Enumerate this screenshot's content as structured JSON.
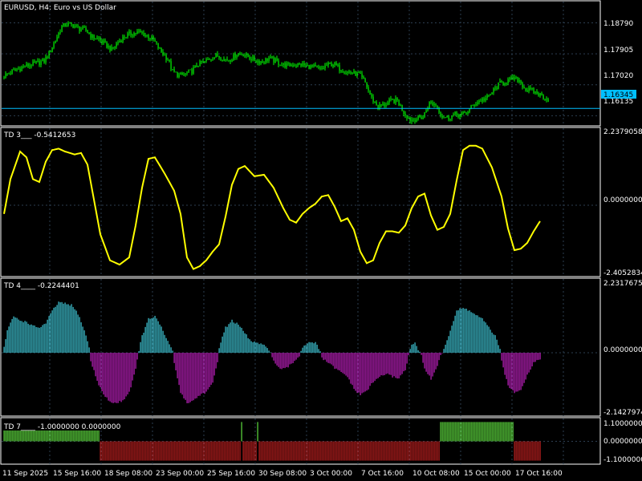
{
  "window": {
    "title": "EURUSD, H4:  Euro vs US Dollar"
  },
  "colors": {
    "background": "#000000",
    "grid": "#2c3e50",
    "border": "#ffffff",
    "candle": "#00ff00",
    "bid_line": "#00bfff",
    "td3_line": "#ffff00",
    "td4_pos": "#40c8d8",
    "td4_neg": "#c020c0",
    "td7_pos": "#60e040",
    "td7_neg": "#c02020",
    "text": "#ffffff"
  },
  "price_panel": {
    "price_labels": [
      "1.18790",
      "1.17905",
      "1.17020",
      "1.16135"
    ],
    "current_price": "1.16345"
  },
  "td3_panel": {
    "label": "TD 3___ -0.5412653",
    "scale_labels": [
      "2.2379058",
      "0.0000000",
      "-2.4052834"
    ]
  },
  "td4_panel": {
    "label": "TD 4____ -0.2244401",
    "scale_labels": [
      "2.2317675",
      "0.0000000",
      "-2.1427974"
    ]
  },
  "td7_panel": {
    "label": "TD 7____ -1.0000000 0.0000000",
    "scale_labels": [
      "1.1000000",
      "0.0000000",
      "-1.1000000"
    ]
  },
  "time_axis": {
    "labels": [
      "11 Sep 2025",
      "15 Sep 16:00",
      "18 Sep 08:00",
      "23 Sep 00:00",
      "25 Sep 16:00",
      "30 Sep 08:00",
      "3 Oct 00:00",
      "7 Oct 16:00",
      "10 Oct 08:00",
      "15 Oct 00:00",
      "17 Oct 16:00"
    ]
  },
  "chart_data": [
    {
      "type": "candlestick",
      "title": "EURUSD, H4:  Euro vs US Dollar",
      "price_anchors": [
        [
          0,
          1.1725
        ],
        [
          6,
          1.174
        ],
        [
          14,
          1.1755
        ],
        [
          20,
          1.1762
        ],
        [
          26,
          1.177
        ],
        [
          30,
          1.18
        ],
        [
          33,
          1.183
        ],
        [
          37,
          1.1868
        ],
        [
          40,
          1.1875
        ],
        [
          44,
          1.1872
        ],
        [
          48,
          1.1862
        ],
        [
          52,
          1.1858
        ],
        [
          56,
          1.1838
        ],
        [
          60,
          1.1832
        ],
        [
          64,
          1.1818
        ],
        [
          68,
          1.1802
        ],
        [
          72,
          1.1824
        ],
        [
          76,
          1.184
        ],
        [
          80,
          1.1848
        ],
        [
          85,
          1.1852
        ],
        [
          90,
          1.1843
        ],
        [
          94,
          1.183
        ],
        [
          98,
          1.1802
        ],
        [
          103,
          1.1775
        ],
        [
          106,
          1.174
        ],
        [
          110,
          1.1728
        ],
        [
          114,
          1.1732
        ],
        [
          118,
          1.1742
        ],
        [
          122,
          1.176
        ],
        [
          126,
          1.1768
        ],
        [
          130,
          1.1779
        ],
        [
          134,
          1.1786
        ],
        [
          138,
          1.1775
        ],
        [
          142,
          1.1775
        ],
        [
          146,
          1.179
        ],
        [
          150,
          1.179
        ],
        [
          154,
          1.178
        ],
        [
          158,
          1.177
        ],
        [
          162,
          1.1768
        ],
        [
          166,
          1.1778
        ],
        [
          170,
          1.177
        ],
        [
          174,
          1.176
        ],
        [
          178,
          1.1757
        ],
        [
          182,
          1.176
        ],
        [
          186,
          1.176
        ],
        [
          190,
          1.1755
        ],
        [
          194,
          1.1752
        ],
        [
          198,
          1.1745
        ],
        [
          202,
          1.1758
        ],
        [
          206,
          1.1762
        ],
        [
          210,
          1.1748
        ],
        [
          214,
          1.174
        ],
        [
          218,
          1.1735
        ],
        [
          222,
          1.1732
        ],
        [
          226,
          1.1708
        ],
        [
          230,
          1.1664
        ],
        [
          234,
          1.164
        ],
        [
          238,
          1.1645
        ],
        [
          242,
          1.1656
        ],
        [
          246,
          1.1657
        ],
        [
          250,
          1.1624
        ],
        [
          254,
          1.1602
        ],
        [
          258,
          1.1605
        ],
        [
          262,
          1.161
        ],
        [
          266,
          1.165
        ],
        [
          270,
          1.1646
        ],
        [
          274,
          1.1612
        ],
        [
          278,
          1.1608
        ],
        [
          282,
          1.1618
        ],
        [
          286,
          1.1615
        ],
        [
          290,
          1.1627
        ],
        [
          294,
          1.1648
        ],
        [
          298,
          1.1658
        ],
        [
          302,
          1.1665
        ],
        [
          306,
          1.1686
        ],
        [
          310,
          1.1706
        ],
        [
          314,
          1.1712
        ],
        [
          318,
          1.172
        ],
        [
          322,
          1.1715
        ],
        [
          326,
          1.1688
        ],
        [
          330,
          1.1685
        ],
        [
          334,
          1.1676
        ],
        [
          338,
          1.1665
        ],
        [
          340,
          1.166
        ]
      ],
      "current": 1.16345,
      "ylim": [
        1.1587,
        1.1935
      ],
      "n_bars": 340
    },
    {
      "type": "line",
      "title": "TD 3___ -0.5412653",
      "anchors": [
        [
          0,
          -0.3
        ],
        [
          4,
          0.9
        ],
        [
          10,
          1.85
        ],
        [
          14,
          1.65
        ],
        [
          18,
          0.9
        ],
        [
          22,
          0.8
        ],
        [
          26,
          1.5
        ],
        [
          30,
          1.9
        ],
        [
          34,
          1.95
        ],
        [
          38,
          1.85
        ],
        [
          44,
          1.75
        ],
        [
          48,
          1.8
        ],
        [
          52,
          1.4
        ],
        [
          56,
          0.2
        ],
        [
          60,
          -1.0
        ],
        [
          66,
          -1.9
        ],
        [
          72,
          -2.05
        ],
        [
          78,
          -1.8
        ],
        [
          82,
          -0.7
        ],
        [
          86,
          0.6
        ],
        [
          90,
          1.6
        ],
        [
          94,
          1.65
        ],
        [
          100,
          1.1
        ],
        [
          106,
          0.5
        ],
        [
          110,
          -0.3
        ],
        [
          114,
          -1.8
        ],
        [
          118,
          -2.2
        ],
        [
          122,
          -2.1
        ],
        [
          126,
          -1.9
        ],
        [
          130,
          -1.6
        ],
        [
          134,
          -1.35
        ],
        [
          138,
          -0.4
        ],
        [
          142,
          0.7
        ],
        [
          146,
          1.25
        ],
        [
          150,
          1.35
        ],
        [
          156,
          1.0
        ],
        [
          162,
          1.05
        ],
        [
          168,
          0.6
        ],
        [
          174,
          -0.1
        ],
        [
          178,
          -0.5
        ],
        [
          182,
          -0.6
        ],
        [
          186,
          -0.3
        ],
        [
          190,
          -0.1
        ],
        [
          194,
          0.05
        ],
        [
          198,
          0.3
        ],
        [
          202,
          0.35
        ],
        [
          206,
          -0.05
        ],
        [
          210,
          -0.55
        ],
        [
          214,
          -0.45
        ],
        [
          218,
          -0.85
        ],
        [
          222,
          -1.6
        ],
        [
          226,
          -2.0
        ],
        [
          230,
          -1.9
        ],
        [
          234,
          -1.3
        ],
        [
          238,
          -0.9
        ],
        [
          242,
          -0.9
        ],
        [
          246,
          -0.95
        ],
        [
          250,
          -0.7
        ],
        [
          254,
          -0.1
        ],
        [
          258,
          0.3
        ],
        [
          262,
          0.4
        ],
        [
          266,
          -0.35
        ],
        [
          270,
          -0.85
        ],
        [
          274,
          -0.75
        ],
        [
          278,
          -0.3
        ],
        [
          282,
          0.85
        ],
        [
          286,
          1.9
        ],
        [
          290,
          2.05
        ],
        [
          294,
          2.05
        ],
        [
          298,
          1.95
        ],
        [
          304,
          1.3
        ],
        [
          310,
          0.3
        ],
        [
          314,
          -0.8
        ],
        [
          318,
          -1.55
        ],
        [
          322,
          -1.5
        ],
        [
          326,
          -1.3
        ],
        [
          330,
          -0.9
        ],
        [
          334,
          -0.55
        ]
      ],
      "ylim": [
        -2.4052834,
        2.2379058
      ]
    },
    {
      "type": "bar",
      "title": "TD 4____ -0.2244401",
      "anchors": [
        [
          0,
          0.2
        ],
        [
          2,
          0.8
        ],
        [
          6,
          1.3
        ],
        [
          10,
          1.15
        ],
        [
          14,
          1.1
        ],
        [
          18,
          0.95
        ],
        [
          22,
          0.9
        ],
        [
          26,
          1.05
        ],
        [
          30,
          1.5
        ],
        [
          34,
          1.8
        ],
        [
          38,
          1.75
        ],
        [
          42,
          1.7
        ],
        [
          46,
          1.4
        ],
        [
          50,
          0.8
        ],
        [
          53,
          0.2
        ],
        [
          54,
          -0.3
        ],
        [
          58,
          -1.0
        ],
        [
          62,
          -1.5
        ],
        [
          66,
          -1.75
        ],
        [
          70,
          -1.8
        ],
        [
          74,
          -1.7
        ],
        [
          78,
          -1.4
        ],
        [
          82,
          -0.6
        ],
        [
          84,
          0.1
        ],
        [
          86,
          0.6
        ],
        [
          90,
          1.2
        ],
        [
          94,
          1.3
        ],
        [
          98,
          0.9
        ],
        [
          102,
          0.4
        ],
        [
          105,
          0.1
        ],
        [
          106,
          -0.4
        ],
        [
          110,
          -1.4
        ],
        [
          114,
          -1.8
        ],
        [
          118,
          -1.7
        ],
        [
          122,
          -1.5
        ],
        [
          126,
          -1.4
        ],
        [
          130,
          -1.1
        ],
        [
          133,
          -0.3
        ],
        [
          134,
          0.2
        ],
        [
          138,
          0.9
        ],
        [
          142,
          1.15
        ],
        [
          146,
          1.0
        ],
        [
          150,
          0.7
        ],
        [
          154,
          0.4
        ],
        [
          158,
          0.35
        ],
        [
          162,
          0.25
        ],
        [
          166,
          0.05
        ],
        [
          168,
          -0.3
        ],
        [
          172,
          -0.6
        ],
        [
          176,
          -0.55
        ],
        [
          180,
          -0.35
        ],
        [
          184,
          -0.1
        ],
        [
          186,
          0.2
        ],
        [
          190,
          0.4
        ],
        [
          194,
          0.35
        ],
        [
          197,
          0.05
        ],
        [
          198,
          -0.2
        ],
        [
          202,
          -0.35
        ],
        [
          206,
          -0.55
        ],
        [
          210,
          -0.7
        ],
        [
          214,
          -0.85
        ],
        [
          218,
          -1.3
        ],
        [
          222,
          -1.5
        ],
        [
          226,
          -1.35
        ],
        [
          230,
          -1.05
        ],
        [
          234,
          -0.85
        ],
        [
          238,
          -0.75
        ],
        [
          242,
          -0.85
        ],
        [
          246,
          -0.9
        ],
        [
          250,
          -0.6
        ],
        [
          252,
          -0.1
        ],
        [
          254,
          0.3
        ],
        [
          256,
          0.35
        ],
        [
          258,
          0.1
        ],
        [
          260,
          -0.1
        ],
        [
          262,
          -0.55
        ],
        [
          266,
          -0.95
        ],
        [
          270,
          -0.45
        ],
        [
          272,
          -0.1
        ],
        [
          274,
          0.1
        ],
        [
          278,
          0.8
        ],
        [
          282,
          1.5
        ],
        [
          286,
          1.6
        ],
        [
          290,
          1.5
        ],
        [
          294,
          1.35
        ],
        [
          298,
          1.2
        ],
        [
          302,
          0.9
        ],
        [
          306,
          0.6
        ],
        [
          309,
          0.1
        ],
        [
          310,
          -0.3
        ],
        [
          314,
          -1.2
        ],
        [
          318,
          -1.4
        ],
        [
          322,
          -1.3
        ],
        [
          326,
          -0.8
        ],
        [
          330,
          -0.35
        ],
        [
          334,
          -0.2
        ]
      ],
      "ylim": [
        -2.1427974,
        2.2317675
      ]
    },
    {
      "type": "bar",
      "title": "TD 7____ -1.0000000 0.0000000",
      "segments": [
        [
          0,
          59,
          1
        ],
        [
          60,
          147,
          -1
        ],
        [
          148,
          148,
          1
        ],
        [
          149,
          157,
          -1
        ],
        [
          158,
          158,
          1
        ],
        [
          159,
          271,
          -1
        ],
        [
          272,
          317,
          1
        ],
        [
          318,
          334,
          -1
        ]
      ],
      "ylim": [
        -1.1,
        1.1
      ]
    }
  ]
}
